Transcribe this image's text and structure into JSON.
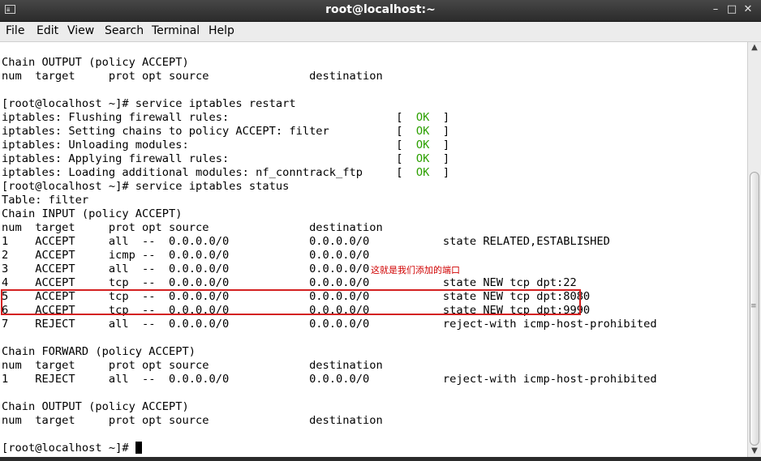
{
  "window": {
    "title": "root@localhost:~",
    "app_icon_glyph": "≣",
    "minimize_glyph": "–",
    "maximize_glyph": "□",
    "close_glyph": "✕"
  },
  "menubar": {
    "items": [
      {
        "label": "File"
      },
      {
        "label": "Edit"
      },
      {
        "label": "View"
      },
      {
        "label": "Search"
      },
      {
        "label": "Terminal"
      },
      {
        "label": "Help"
      }
    ]
  },
  "terminal": {
    "lines": [
      "Chain OUTPUT (policy ACCEPT)",
      "num  target     prot opt source               destination",
      "",
      "[root@localhost ~]# service iptables restart",
      "iptables: Flushing firewall rules:                         [  ",
      "iptables: Setting chains to policy ACCEPT: filter          [  ",
      "iptables: Unloading modules:                               [  ",
      "iptables: Applying firewall rules:                         [  ",
      "iptables: Loading additional modules: nf_conntrack_ftp     [  ",
      "[root@localhost ~]# service iptables status",
      "Table: filter",
      "Chain INPUT (policy ACCEPT)",
      "num  target     prot opt source               destination",
      "1    ACCEPT     all  --  0.0.0.0/0            0.0.0.0/0           state RELATED,ESTABLISHED",
      "2    ACCEPT     icmp --  0.0.0.0/0            0.0.0.0/0",
      "3    ACCEPT     all  --  0.0.0.0/0            0.0.0.0/0",
      "4    ACCEPT     tcp  --  0.0.0.0/0            0.0.0.0/0           state NEW tcp dpt:22",
      "5    ACCEPT     tcp  --  0.0.0.0/0            0.0.0.0/0           state NEW tcp dpt:8080",
      "6    ACCEPT     tcp  --  0.0.0.0/0            0.0.0.0/0           state NEW tcp dpt:9990",
      "7    REJECT     all  --  0.0.0.0/0            0.0.0.0/0           reject-with icmp-host-prohibited",
      "",
      "Chain FORWARD (policy ACCEPT)",
      "num  target     prot opt source               destination",
      "1    REJECT     all  --  0.0.0.0/0            0.0.0.0/0           reject-with icmp-host-prohibited",
      "",
      "Chain OUTPUT (policy ACCEPT)",
      "num  target     prot opt source               destination",
      "",
      "[root@localhost ~]# "
    ],
    "ok_label": "OK",
    "ok_suffix": "  ]",
    "annotation": "这就是我们添加的端口",
    "colors": {
      "ok": "#2ca000",
      "annotation": "#d00000",
      "highlight_box": "#d42020"
    }
  },
  "scrollbar": {
    "up_glyph": "▲",
    "down_glyph": "▼",
    "grip_glyph": "≡"
  }
}
